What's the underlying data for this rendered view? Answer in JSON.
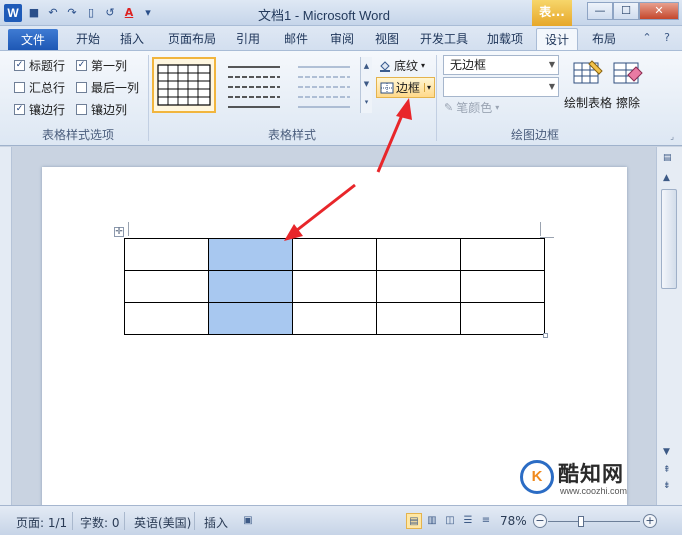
{
  "window": {
    "title": "文档1 - Microsoft Word",
    "context_tab_label": "表...",
    "app_icon_letter": "W",
    "minimize": "—",
    "restore": "☐",
    "close": "✕"
  },
  "quick_access": {
    "save_glyph": "■",
    "undo_glyph": "↶",
    "redo_glyph": "↷",
    "new_glyph": "▯",
    "repeat_glyph": "↺",
    "font_color_glyph": "A",
    "customize_glyph": "▾"
  },
  "tabs": [
    {
      "label": "文件"
    },
    {
      "label": "开始"
    },
    {
      "label": "插入"
    },
    {
      "label": "页面布局"
    },
    {
      "label": "引用"
    },
    {
      "label": "邮件"
    },
    {
      "label": "审阅"
    },
    {
      "label": "视图"
    },
    {
      "label": "开发工具"
    },
    {
      "label": "加载项"
    },
    {
      "label": "设计"
    },
    {
      "label": "布局"
    }
  ],
  "active_tab": "设计",
  "ribbon": {
    "table_style_options": {
      "group_label": "表格样式选项",
      "options": [
        {
          "label": "标题行",
          "checked": true
        },
        {
          "label": "第一列",
          "checked": true
        },
        {
          "label": "汇总行",
          "checked": false
        },
        {
          "label": "最后一列",
          "checked": false
        },
        {
          "label": "镶边行",
          "checked": true
        },
        {
          "label": "镶边列",
          "checked": false
        }
      ],
      "check_glyph": "✓"
    },
    "table_styles": {
      "group_label": "表格样式",
      "shading_label": "底纹",
      "borders_label": "边框",
      "dropdown_glyph": "▾"
    },
    "draw_borders": {
      "group_label": "绘图边框",
      "line_style_value": "无边框",
      "line_weight_value": "",
      "pen_color_label": "笔颜色",
      "draw_table_label": "绘制表格",
      "eraser_label": "擦除"
    }
  },
  "document": {
    "table_rows": 3,
    "table_cols": 5,
    "selected_column": 2,
    "move_handle_glyph": "✛"
  },
  "watermark": {
    "logo_letter": "K",
    "name": "酷知网",
    "url": "www.coozhi.com"
  },
  "status_bar": {
    "page": "页面: 1/1",
    "words": "字数: 0",
    "language": "英语(美国)",
    "mode": "插入",
    "zoom": "78%",
    "zoom_level": 0.4
  },
  "colors": {
    "selected_cell": "#a8c8f0",
    "arrow": "#e8262a",
    "file_tab": "#1c56b3",
    "context_tab": "#e6a72a"
  }
}
